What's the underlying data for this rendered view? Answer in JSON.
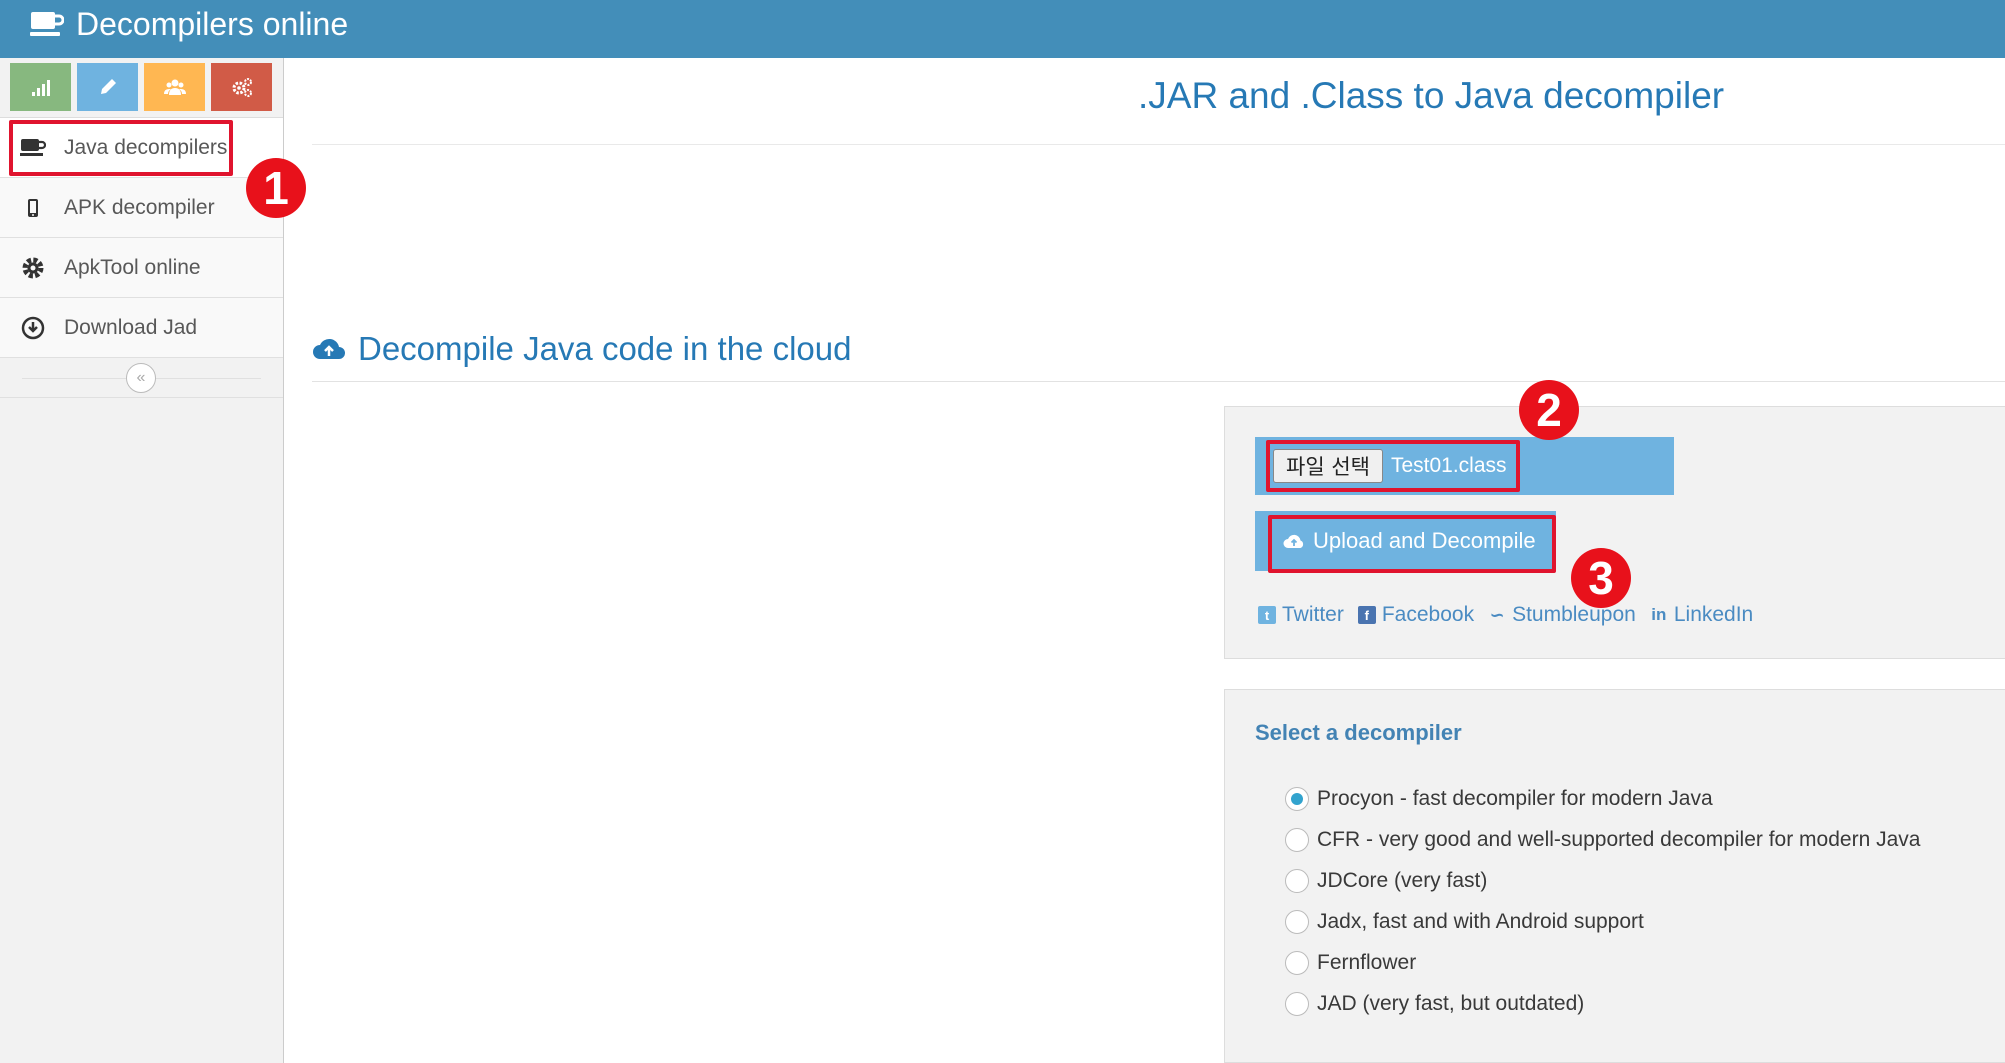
{
  "navbar": {
    "brand": "Decompilers online",
    "brand_icon": "coffee-cup-icon",
    "background": "#438eb9"
  },
  "sidebar": {
    "shortcuts": [
      {
        "icon": "signal-icon",
        "color": "#87b87f"
      },
      {
        "icon": "pencil-icon",
        "color": "#6fb3e0"
      },
      {
        "icon": "users-icon",
        "color": "#ffb752"
      },
      {
        "icon": "cogs-icon",
        "color": "#d15b47"
      }
    ],
    "items": [
      {
        "label": "Java decompilers",
        "icon": "coffee-cup-icon",
        "active": true
      },
      {
        "label": "APK decompiler",
        "icon": "mobile-phone-icon"
      },
      {
        "label": "ApkTool online",
        "icon": "gear-icon"
      },
      {
        "label": "Download Jad",
        "icon": "download-circle-icon"
      }
    ],
    "collapse_glyph": "«"
  },
  "main": {
    "page_title": ".JAR and .Class to Java decompiler",
    "section_title": "Decompile Java code in the cloud",
    "upload": {
      "file_button": "파일 선택",
      "file_name": "Test01.class",
      "upload_button": "Upload and Decompile"
    },
    "share": [
      "Twitter",
      "Facebook",
      "Stumbleupon",
      "LinkedIn"
    ],
    "decompiler": {
      "title": "Select a decompiler",
      "options": [
        {
          "label": "Procyon - fast decompiler for modern Java",
          "checked": true
        },
        {
          "label": "CFR - very good and well-supported decompiler for modern Java",
          "checked": false
        },
        {
          "label": "JDCore (very fast)",
          "checked": false
        },
        {
          "label": "Jadx, fast and with Android support",
          "checked": false
        },
        {
          "label": "Fernflower",
          "checked": false
        },
        {
          "label": "JAD (very fast, but outdated)",
          "checked": false
        }
      ]
    }
  },
  "annotations": {
    "step1": "1",
    "step2": "2",
    "step3": "3",
    "color": "#e0142e"
  }
}
